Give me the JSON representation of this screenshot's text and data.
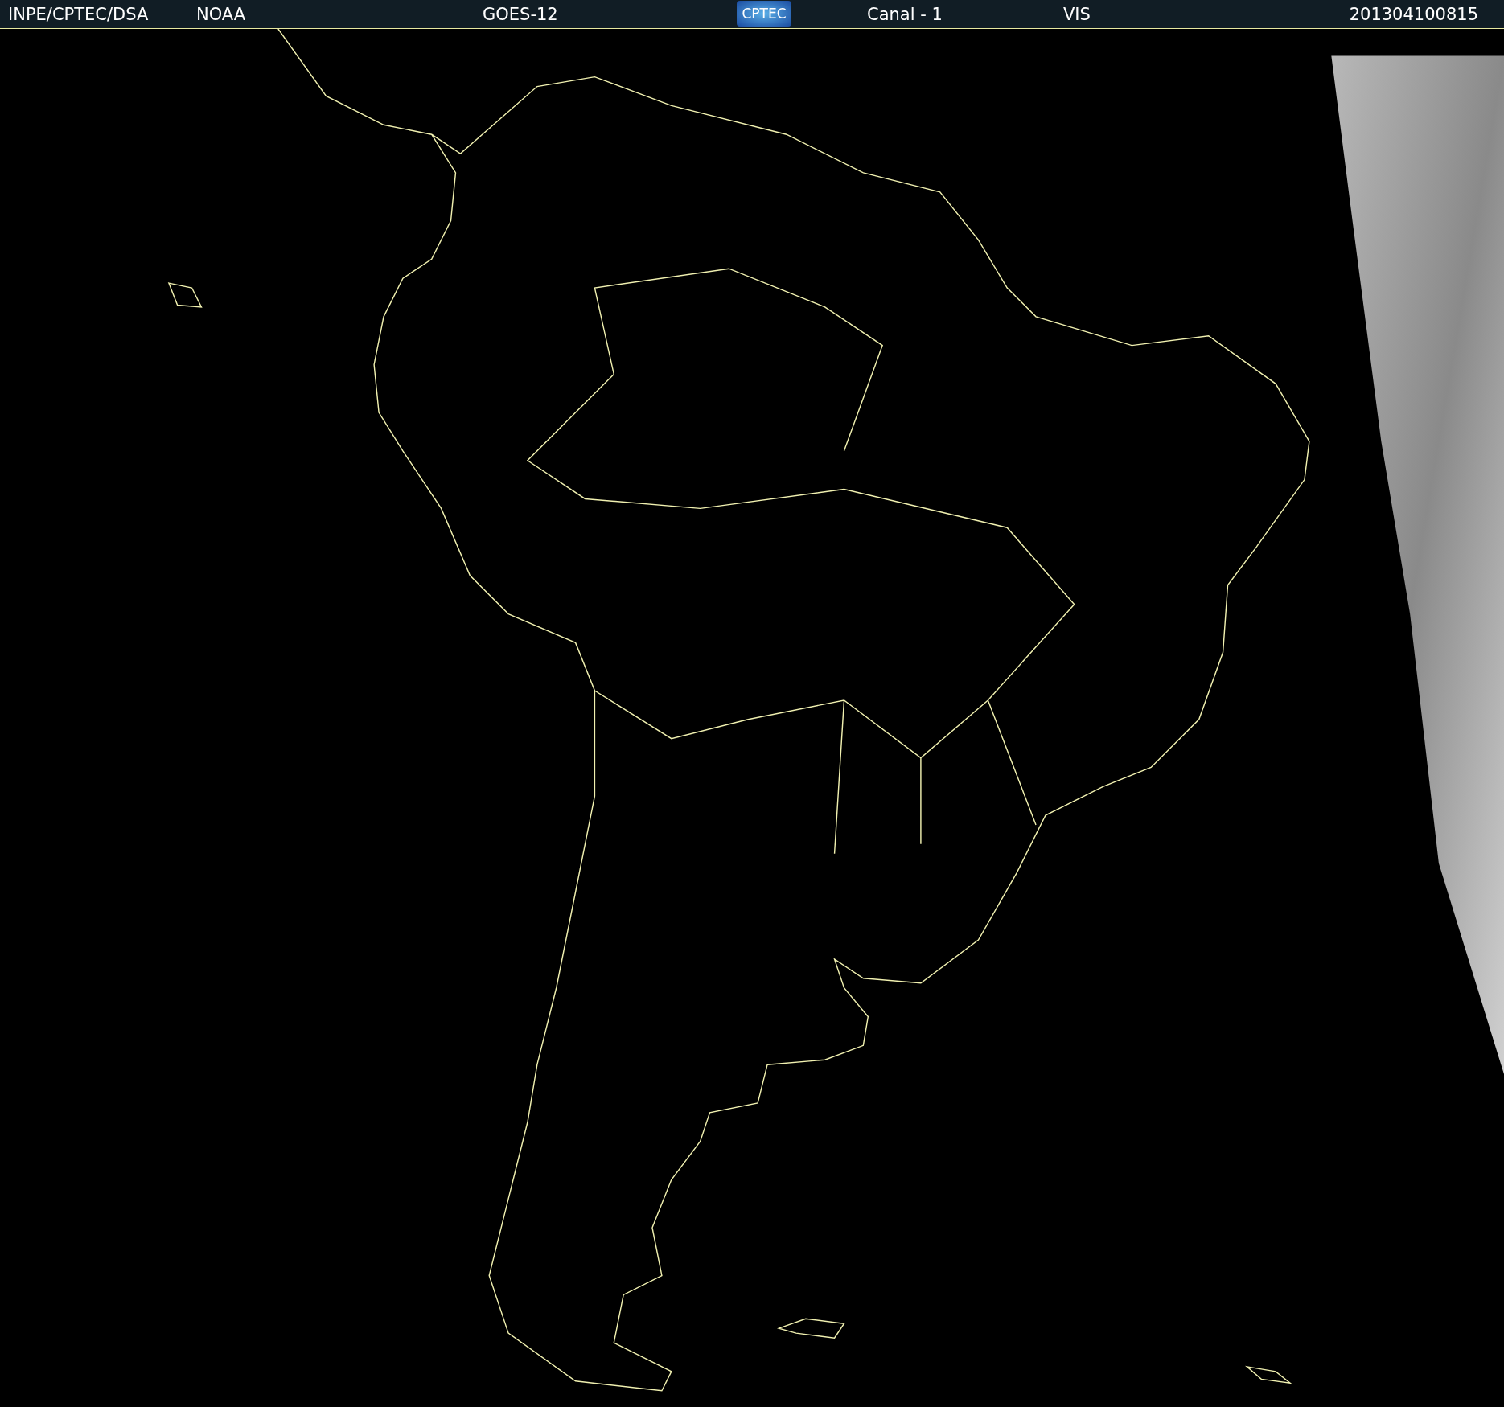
{
  "header": {
    "labels": [
      "INPE/CPTEC/DSA",
      "NOAA",
      "GOES-12"
    ],
    "logo": "CPTEC",
    "labels_right": [
      "Canal - 1",
      "VIS"
    ],
    "timestamp": "201304100815"
  }
}
